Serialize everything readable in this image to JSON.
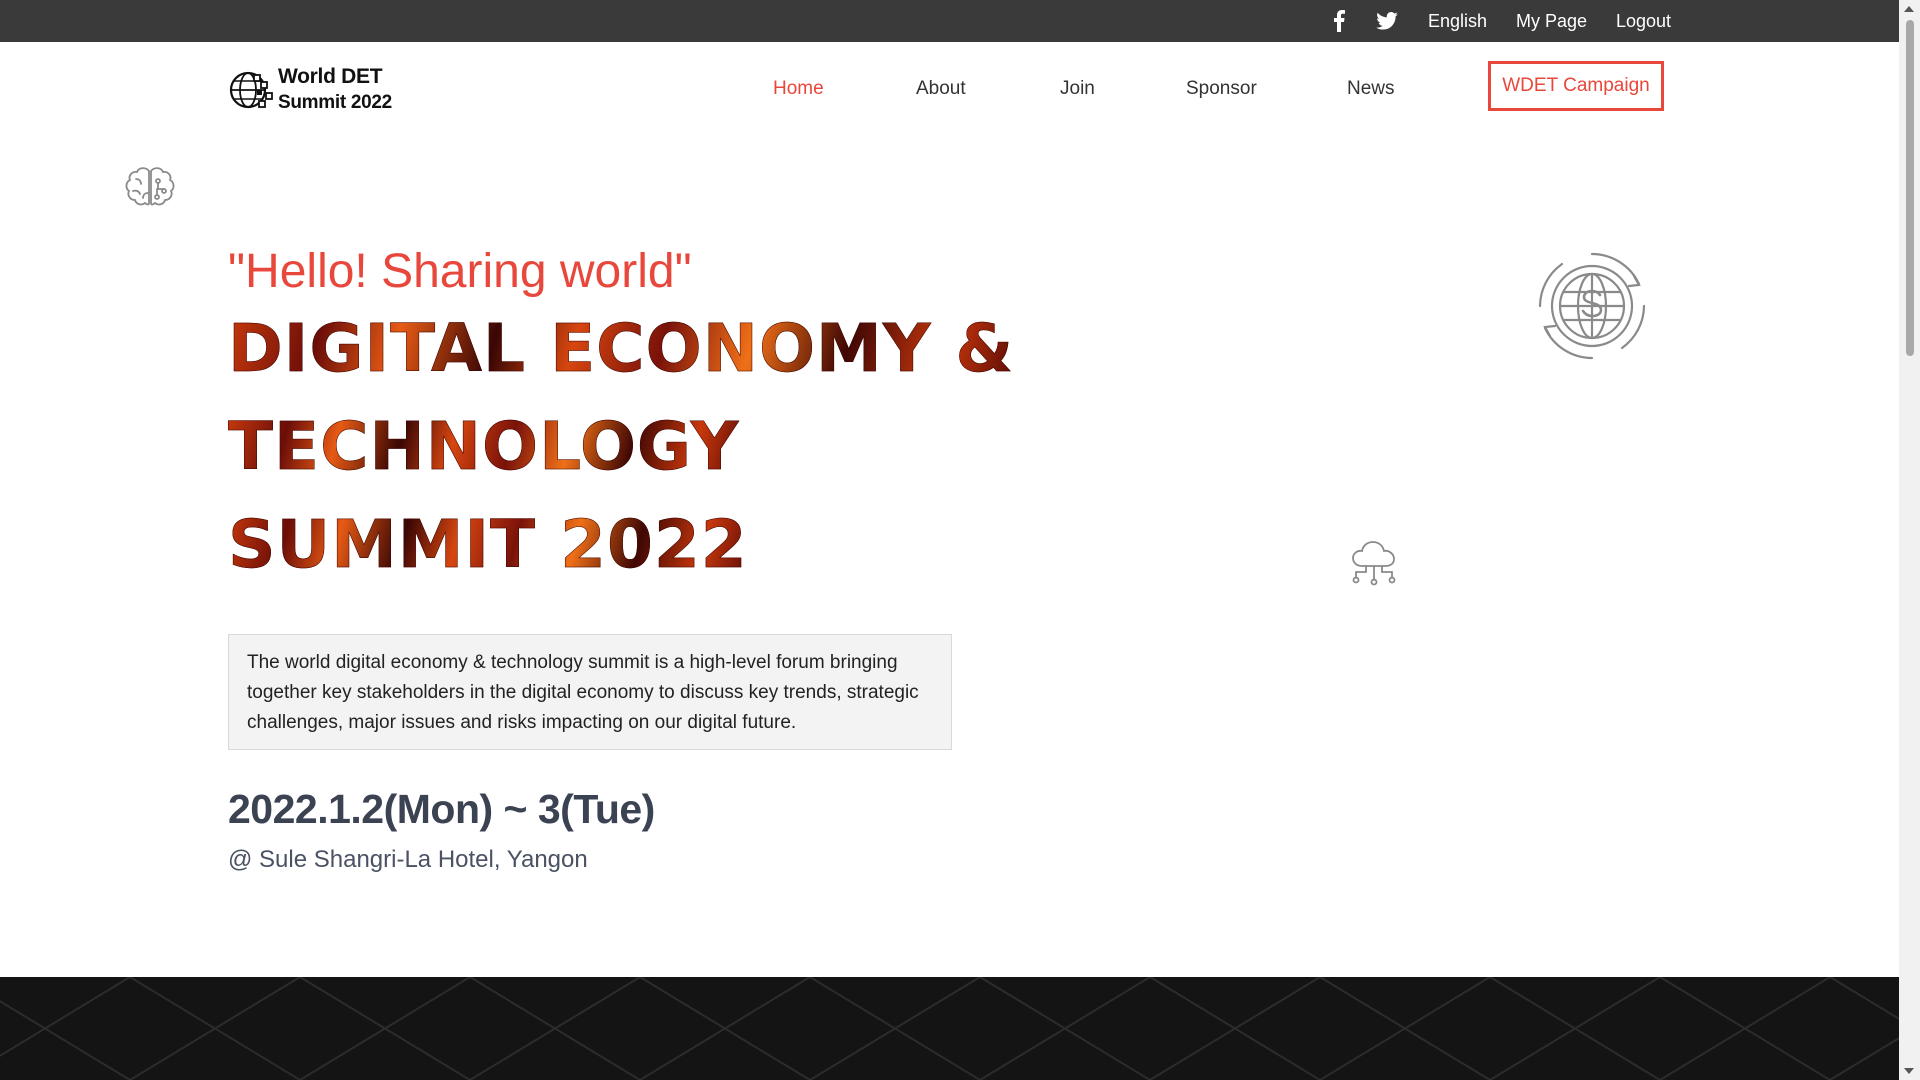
{
  "topbar": {
    "facebook_icon": "facebook-icon",
    "twitter_icon": "twitter-icon",
    "language": "English",
    "my_page": "My Page",
    "logout": "Logout"
  },
  "header": {
    "logo_line1": "World DET",
    "logo_line2": "Summit 2022",
    "nav": {
      "home": "Home",
      "about": "About",
      "join": "Join",
      "sponsor": "Sponsor",
      "news": "News",
      "campaign": "WDET Campaign"
    }
  },
  "hero": {
    "tagline": "\"Hello! Sharing world\"",
    "title_line1": "DIGITAL ECONOMY &",
    "title_line2": "TECHNOLOGY",
    "title_line3": "SUMMIT 2022",
    "description": "The world digital economy & technology summit is a high-level forum bringing together key stakeholders in the digital economy to discuss key trends, strategic challenges, major issues and risks impacting on our digital future.",
    "date": "2022.1.2(Mon) ~ 3(Tue)",
    "venue": "@ Sule Shangri-La Hotel, Yangon",
    "decor_icons": [
      "brain-icon",
      "globe-dollar-icon",
      "cloud-network-icon"
    ]
  },
  "colors": {
    "accent": "#e8473c",
    "topbar_bg": "#3a3a3a",
    "date_text": "#3b4252",
    "dark_band": "#141414"
  }
}
